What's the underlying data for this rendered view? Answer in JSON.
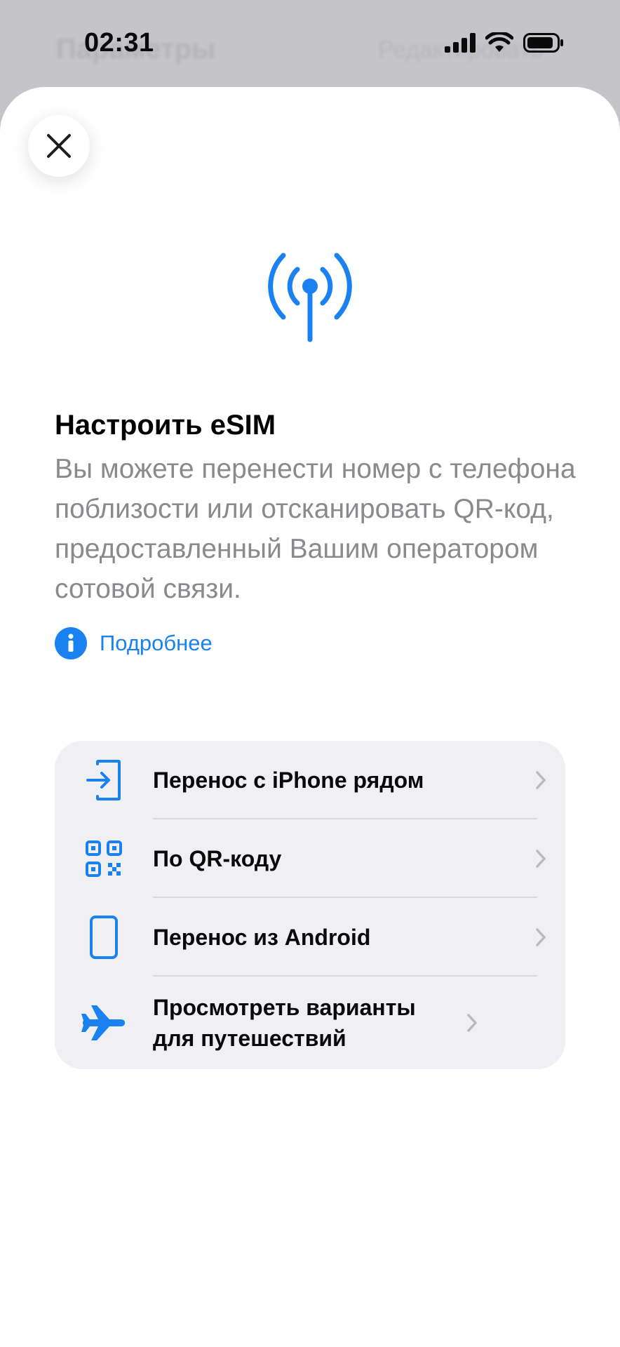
{
  "status_bar": {
    "time": "02:31"
  },
  "background_page": {
    "title": "Параметры",
    "right_action": "Редактировать"
  },
  "sheet": {
    "title": "Настроить eSIM",
    "description": "Вы можете перенести номер с телефона поблизости или отсканировать QR-код, предоставленный Вашим оператором сотовой связи.",
    "more_link": "Подробнее",
    "options": [
      {
        "label": "Перенос с iPhone рядом",
        "icon": "transfer-in-icon"
      },
      {
        "label": "По QR-коду",
        "icon": "qr-code-icon"
      },
      {
        "label": "Перенос из Android",
        "icon": "phone-outline-icon"
      },
      {
        "label": "Просмотреть варианты для путешествий",
        "icon": "airplane-icon"
      }
    ]
  },
  "colors": {
    "accent": "#1a82f0",
    "sheet_background": "#ffffff",
    "group_background": "#efeff4",
    "secondary_text": "#8a8a8e"
  }
}
